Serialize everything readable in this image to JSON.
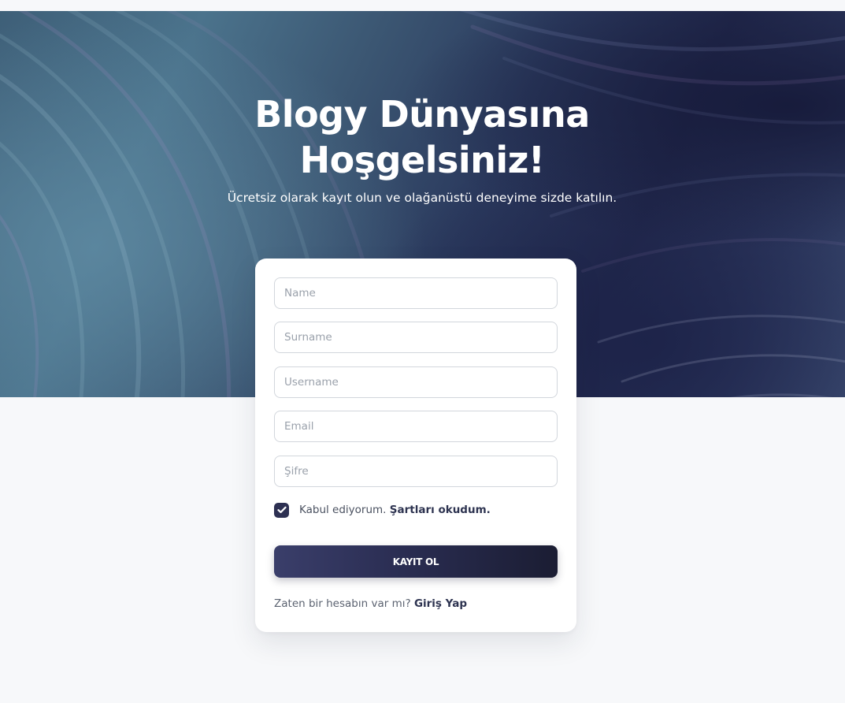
{
  "hero": {
    "title_line1": "Blogy Dünyasına",
    "title_line2": "Hoşgelsiniz!",
    "subtitle": "Ücretsiz olarak kayıt olun ve olağanüstü deneyime sizde katılın."
  },
  "form": {
    "fields": {
      "name": {
        "placeholder": "Name",
        "value": ""
      },
      "surname": {
        "placeholder": "Surname",
        "value": ""
      },
      "username": {
        "placeholder": "Username",
        "value": ""
      },
      "email": {
        "placeholder": "Email",
        "value": ""
      },
      "password": {
        "placeholder": "Şifre",
        "value": ""
      }
    },
    "terms": {
      "checked": true,
      "text": "Kabul ediyorum.",
      "link": "Şartları okudum."
    },
    "submit_label": "KAYIT OL",
    "login_prompt": "Zaten bir hesabın var mı?",
    "login_link": "Giriş Yap"
  },
  "icons": {
    "checkbox": "check-icon"
  },
  "colors": {
    "accent": "#2d3052",
    "button_start": "#3a3e6a",
    "button_end": "#1b1d33",
    "page_background": "#f7f8fa"
  }
}
